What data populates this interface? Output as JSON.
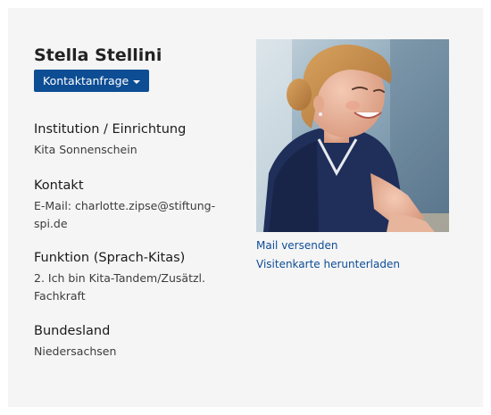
{
  "profile": {
    "name": "Stella Stellini",
    "contact_button": "Kontaktanfrage",
    "photo_alt": "Profilfoto"
  },
  "sections": [
    {
      "heading": "Institution / Einrichtung",
      "lines": [
        "Kita Sonnenschein"
      ]
    },
    {
      "heading": "Kontakt",
      "lines": [
        "E-Mail: charlotte.zipse@stiftung-",
        "spi.de"
      ]
    },
    {
      "heading": "Funktion (Sprach-Kitas)",
      "lines": [
        "2. Ich bin Kita-Tandem/Zusätzl.",
        "Fachkraft"
      ]
    },
    {
      "heading": "Bundesland",
      "lines": [
        "Niedersachsen"
      ]
    }
  ],
  "links": {
    "mail": "Mail versenden",
    "vcard": "Visitenkarte herunterladen"
  },
  "colors": {
    "card_bg": "#f5f5f6",
    "accent": "#0d4d94"
  },
  "icons": {
    "dropdown": "caret-down-icon"
  }
}
